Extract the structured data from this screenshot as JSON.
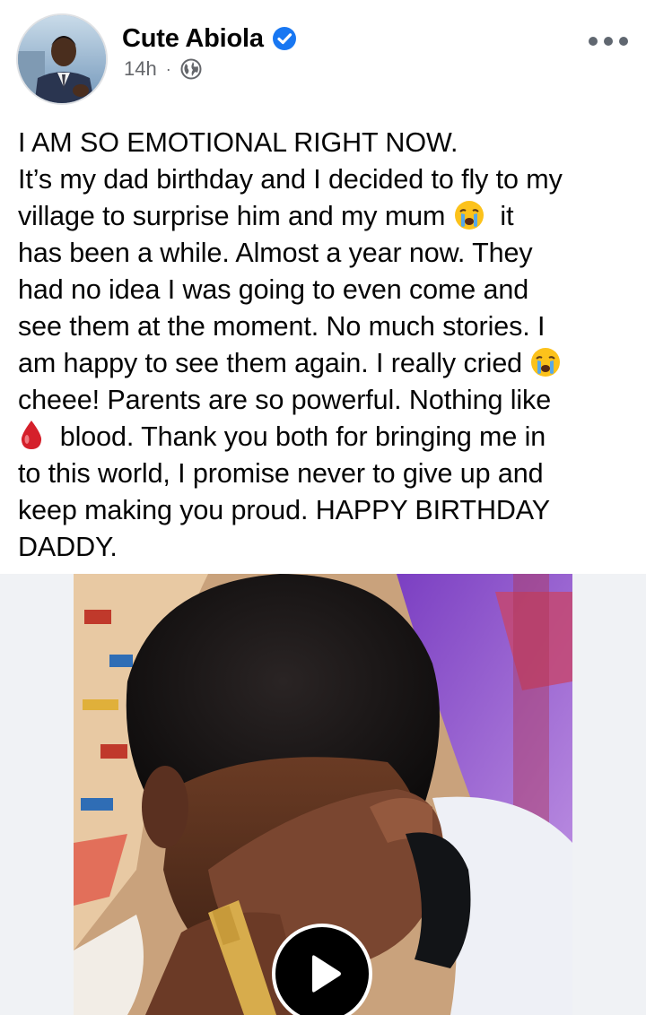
{
  "post": {
    "author": "Cute Abiola",
    "verified": true,
    "time": "14h",
    "privacy_icon": "globe-icon",
    "more_icon": "more-options-icon",
    "text": {
      "l1": "I AM SO EMOTIONAL RIGHT NOW.",
      "l2": "It’s my dad birthday and I decided to fly to my",
      "l3a": "village to surprise him and my mum ",
      "l3b": "  it",
      "l4": "has been a while. Almost a year now. They",
      "l5": "had no idea I was going to even come and",
      "l6": "see them at the moment. No much stories. I",
      "l7a": "am happy to see them again. I really cried ",
      "l8": "cheee! Parents are so powerful. Nothing like",
      "l9b": "  blood. Thank you both for bringing me in",
      "l10": "to this world, I promise never to give up and",
      "l11": "keep making you proud. HAPPY BIRTHDAY",
      "l12": "DADDY."
    },
    "emojis": [
      "crying-face-emoji",
      "crying-face-emoji",
      "drop-of-blood-emoji"
    ],
    "media": {
      "type": "video",
      "play_icon": "play-icon"
    }
  },
  "colors": {
    "verified_blue": "#1877f2",
    "meta_gray": "#65676b"
  }
}
